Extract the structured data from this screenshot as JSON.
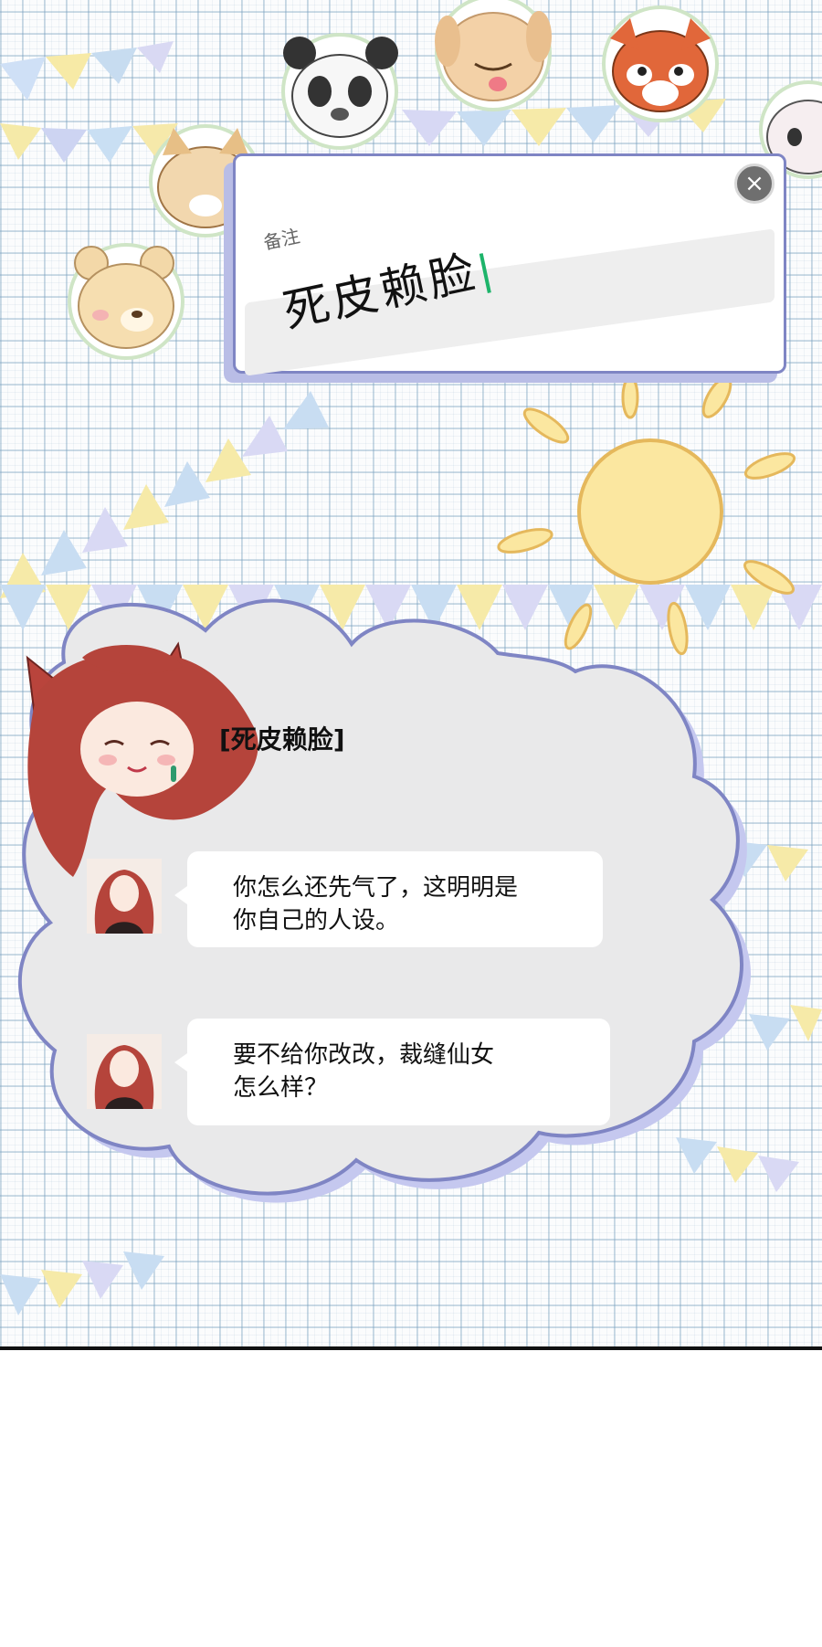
{
  "remark": {
    "label": "备注",
    "value": "死皮赖脸",
    "close_icon": "close-icon"
  },
  "speaker": {
    "name_tag": "[死皮赖脸]"
  },
  "messages": [
    {
      "line1": "你怎么还先气了，这明明是",
      "line2": "你自己的人设。"
    },
    {
      "line1": "要不给你改改，裁缝仙女",
      "line2": "怎么样？"
    }
  ],
  "decorations": {
    "stickers": [
      "panda-sticker",
      "puppy-sticker",
      "red-panda-sticker",
      "bear-sticker",
      "shiba-sticker",
      "hamster-sticker"
    ],
    "sun": "sun-illustration",
    "bunting": "pennant-bunting"
  },
  "colors": {
    "cloud_fill": "#e9e9ea",
    "cloud_border": "#7f85c4",
    "cloud_shadow": "#c5c8ef",
    "sun": "#fbe7a0",
    "sun_stroke": "#e5b85c",
    "caret": "#1db46a"
  }
}
